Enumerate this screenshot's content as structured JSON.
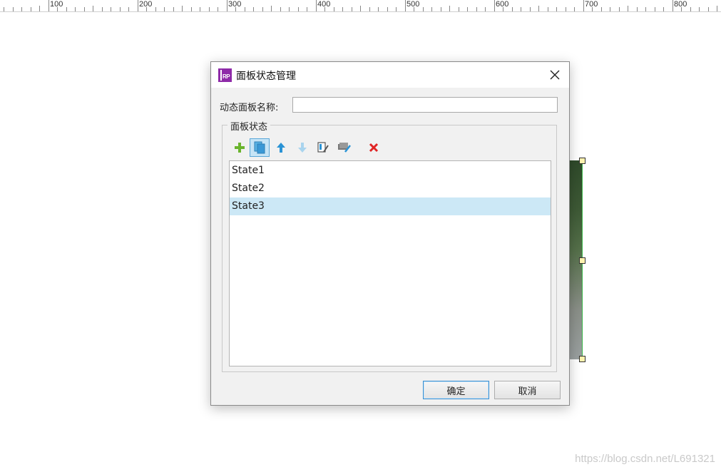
{
  "ruler": {
    "labels": [
      "100",
      "200",
      "300",
      "400",
      "500",
      "600",
      "700",
      "800"
    ]
  },
  "dialog": {
    "title": "面板状态管理",
    "name_label": "动态面板名称:",
    "name_value": "",
    "group_label": "面板状态",
    "toolbar": {
      "icons": [
        "add-icon",
        "duplicate-icon",
        "move-up-icon",
        "move-down-icon",
        "edit-state-icon",
        "edit-all-icon",
        "delete-icon"
      ]
    },
    "states": [
      {
        "label": "State1",
        "selected": false
      },
      {
        "label": "State2",
        "selected": false
      },
      {
        "label": "State3",
        "selected": true
      }
    ],
    "ok_label": "确定",
    "cancel_label": "取消"
  },
  "watermark": "https://blog.csdn.net/L691321",
  "colors": {
    "accent": "#5aa7d8",
    "selection": "#cce8f6",
    "app_icon": "#8e2aa8"
  }
}
